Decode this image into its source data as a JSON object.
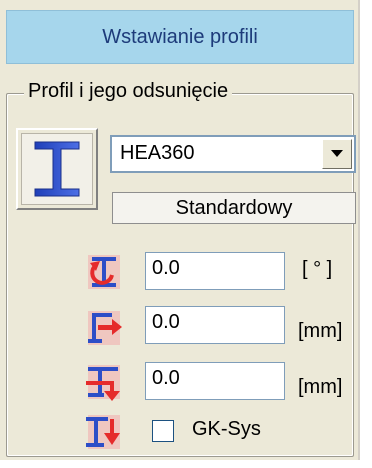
{
  "panel": {
    "title": "Wstawianie profili"
  },
  "group": {
    "legend": "Profil i jego odsunięcie"
  },
  "profile": {
    "selected": "HEA360",
    "standard_label": "Standardowy"
  },
  "fields": [
    {
      "value": "0.0",
      "unit": "[ ° ]"
    },
    {
      "value": "0.0",
      "unit": "[mm]"
    },
    {
      "value": "0.0",
      "unit": "[mm]"
    }
  ],
  "gksys": {
    "label": "GK-Sys",
    "checked": false
  },
  "colors": {
    "title_bg": "#a6d6ec",
    "title_text": "#1d3b7a",
    "panel_bg": "#ece9d8",
    "icon_red": "#e52b2b",
    "icon_blue": "#2d4ec7"
  }
}
